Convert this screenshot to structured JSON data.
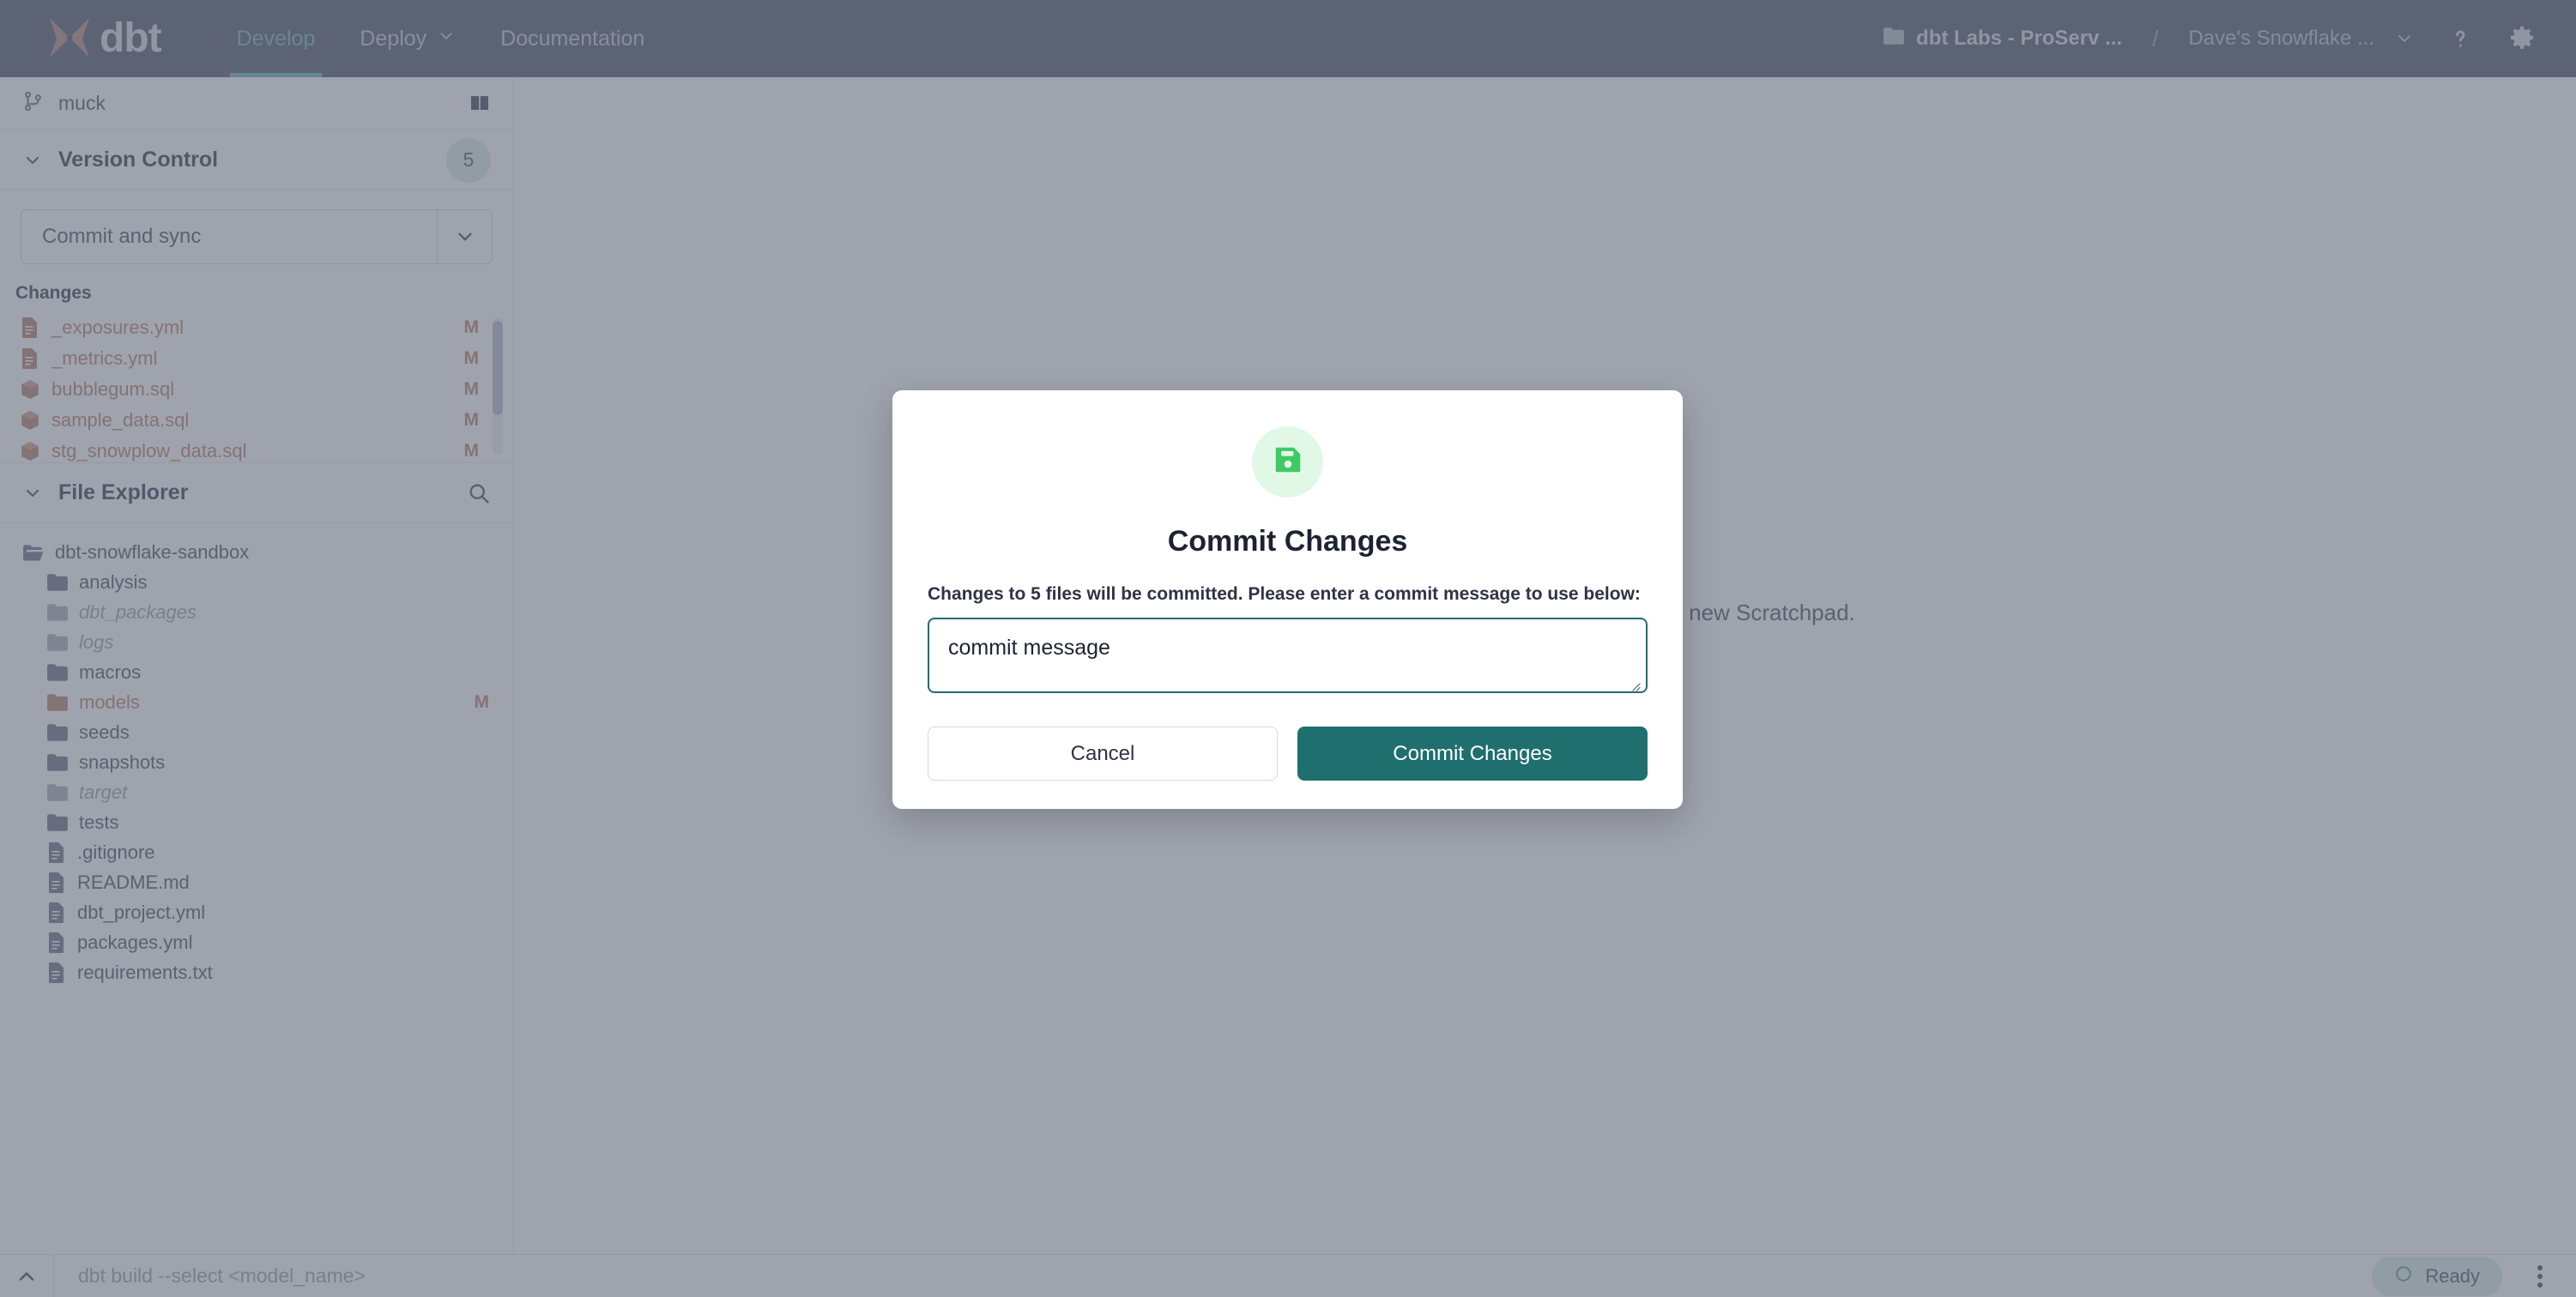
{
  "nav": {
    "brand": "dbt",
    "brand_icon": "dbt-logo-icon",
    "links": [
      {
        "label": "Develop",
        "active": true,
        "has_caret": false
      },
      {
        "label": "Deploy",
        "active": false,
        "has_caret": true
      },
      {
        "label": "Documentation",
        "active": false,
        "has_caret": false
      }
    ],
    "breadcrumb": {
      "folder_icon": "folder-icon",
      "project": "dbt Labs - ProServ ...",
      "separator": "/",
      "environment": "Dave's Snowflake ...",
      "caret_icon": "chevron-down-icon"
    },
    "help_icon": "question-mark-icon",
    "settings_icon": "gear-icon"
  },
  "sidebar": {
    "branch": {
      "icon": "git-branch-icon",
      "name": "muck",
      "book_icon": "book-icon"
    },
    "version_control": {
      "title": "Version Control",
      "caret_icon": "chevron-down-icon",
      "badge": "5",
      "commit_sync_label": "Commit and sync",
      "commit_sync_caret": "chevron-down-icon",
      "changes_label": "Changes",
      "changes": [
        {
          "name": "_exposures.yml",
          "flag": "M",
          "icon": "file-icon"
        },
        {
          "name": "_metrics.yml",
          "flag": "M",
          "icon": "file-icon"
        },
        {
          "name": "bubblegum.sql",
          "flag": "M",
          "icon": "model-cube-icon"
        },
        {
          "name": "sample_data.sql",
          "flag": "M",
          "icon": "model-cube-icon"
        },
        {
          "name": "stg_snowplow_data.sql",
          "flag": "M",
          "icon": "model-cube-icon"
        }
      ]
    },
    "file_explorer": {
      "title": "File Explorer",
      "caret_icon": "chevron-down-icon",
      "search_icon": "search-icon",
      "tree": [
        {
          "name": "dbt-snowflake-sandbox",
          "type": "folder-open",
          "indent": 0,
          "dim": false,
          "flag": ""
        },
        {
          "name": "analysis",
          "type": "folder",
          "indent": 1,
          "dim": false,
          "flag": ""
        },
        {
          "name": "dbt_packages",
          "type": "folder",
          "indent": 1,
          "dim": true,
          "flag": ""
        },
        {
          "name": "logs",
          "type": "folder",
          "indent": 1,
          "dim": true,
          "flag": ""
        },
        {
          "name": "macros",
          "type": "folder",
          "indent": 1,
          "dim": false,
          "flag": ""
        },
        {
          "name": "models",
          "type": "folder",
          "indent": 1,
          "dim": false,
          "flag": "M",
          "modified": true
        },
        {
          "name": "seeds",
          "type": "folder",
          "indent": 1,
          "dim": false,
          "flag": ""
        },
        {
          "name": "snapshots",
          "type": "folder",
          "indent": 1,
          "dim": false,
          "flag": ""
        },
        {
          "name": "target",
          "type": "folder",
          "indent": 1,
          "dim": true,
          "flag": ""
        },
        {
          "name": "tests",
          "type": "folder",
          "indent": 1,
          "dim": false,
          "flag": ""
        },
        {
          "name": ".gitignore",
          "type": "file",
          "indent": 1,
          "dim": false,
          "flag": ""
        },
        {
          "name": "README.md",
          "type": "file",
          "indent": 1,
          "dim": false,
          "flag": ""
        },
        {
          "name": "dbt_project.yml",
          "type": "file",
          "indent": 1,
          "dim": false,
          "flag": ""
        },
        {
          "name": "packages.yml",
          "type": "file",
          "indent": 1,
          "dim": false,
          "flag": ""
        },
        {
          "name": "requirements.txt",
          "type": "file",
          "indent": 1,
          "dim": false,
          "flag": ""
        }
      ]
    }
  },
  "main": {
    "empty_text": "Select a file from the File Explorer or create a new Scratchpad."
  },
  "bottom_bar": {
    "caret_icon": "chevron-up-icon",
    "command_placeholder": "dbt build --select <model_name>",
    "status_label": "Ready",
    "status_icon": "circle-icon",
    "menu_icon": "kebab-menu-icon"
  },
  "modal": {
    "icon": "save-floppy-icon",
    "title": "Commit Changes",
    "description": "Changes to 5 files will be committed. Please enter a commit message to use below:",
    "textarea_value": "commit message",
    "textarea_placeholder": "",
    "cancel_label": "Cancel",
    "confirm_label": "Commit Changes"
  },
  "colors": {
    "nav_bg": "#505869",
    "nav_active": "#6fb6b6",
    "accent_teal": "#1f6f6f",
    "modified_orange": "#b5816a",
    "icon_green": "#3fca63",
    "icon_green_bg": "#e2f8e6",
    "badge_bg": "#d9ecea"
  }
}
